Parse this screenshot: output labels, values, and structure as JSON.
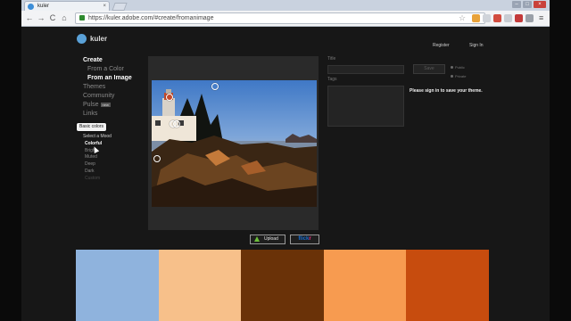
{
  "browser": {
    "tab_title": "kuler",
    "tab_close": "×",
    "url": "https://kuler.adobe.com/#create/fromanimage",
    "buttons": {
      "back": "←",
      "forward": "→",
      "reload": "C",
      "home": "⌂",
      "star": "☆",
      "menu": "≡"
    },
    "window": {
      "minimize": "–",
      "maximize": "□",
      "close": "×"
    }
  },
  "header": {
    "logo_text": "kuler",
    "register": "Register",
    "sign_in": "Sign In"
  },
  "nav": {
    "create": "Create",
    "from_a_color": "From a Color",
    "from_an_image": "From an Image",
    "themes": "Themes",
    "community": "Community",
    "pulse": "Pulse",
    "pulse_badge": "new",
    "links": "Links"
  },
  "tooltip": "Basic colors",
  "moods": {
    "label": "Select a Mood",
    "items": [
      "Colorful",
      "Bright",
      "Muted",
      "Deep",
      "Dark",
      "Custom"
    ]
  },
  "upload_label": "Upload",
  "flickr": {
    "part1": "flick",
    "part2": "r"
  },
  "form": {
    "title_label": "Title",
    "tags_label": "Tags",
    "save_label": "Save",
    "public_label": "Public",
    "private_label": "Private",
    "signin_message": "Please sign in to save your theme."
  },
  "swatches": [
    "#8fb3dd",
    "#f7c08a",
    "#6a3208",
    "#f79b50",
    "#c74c0e"
  ]
}
